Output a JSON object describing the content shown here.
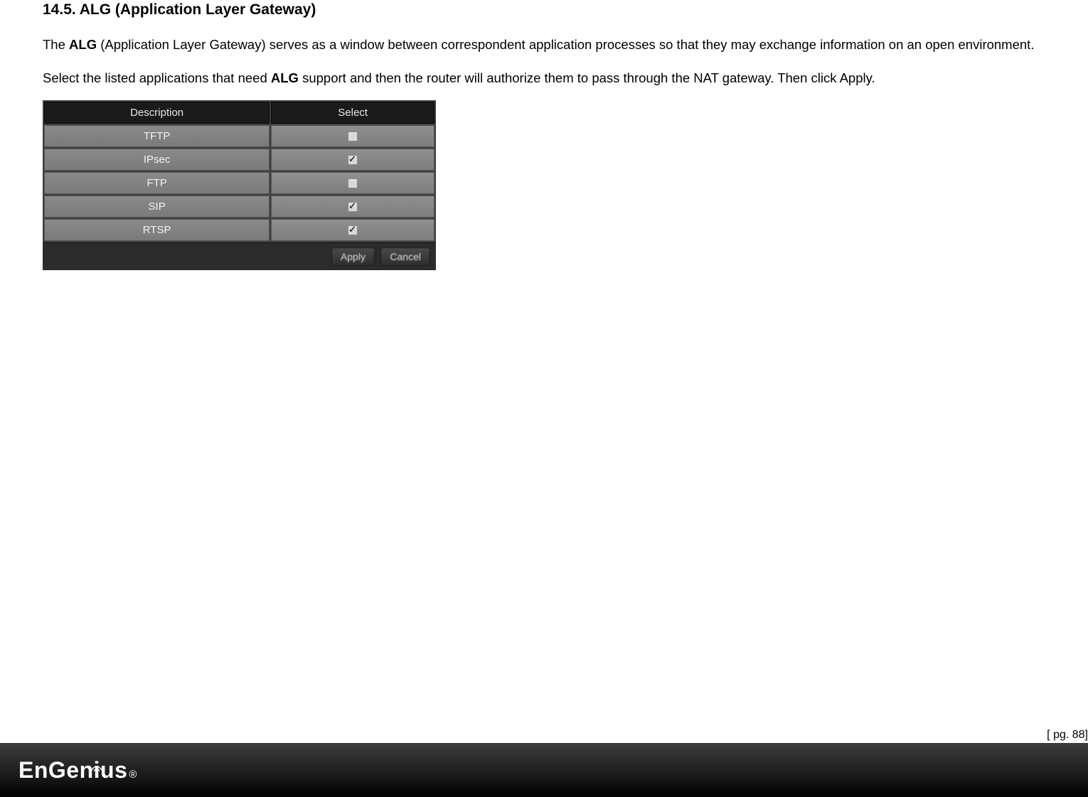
{
  "section": {
    "heading": "14.5.  ALG (Application Layer Gateway)",
    "para1_lead": "The ",
    "para1_bold1": "ALG",
    "para1_mid": " (Application Layer Gateway) serves as a window between correspondent application processes so that they may exchange information on an open environment.",
    "para2_lead": "Select the listed applications that need ",
    "para2_bold1": "ALG",
    "para2_tail": " support and then the router will authorize them to pass through the NAT gateway. Then click Apply."
  },
  "table": {
    "headers": {
      "description": "Description",
      "select": "Select"
    },
    "rows": [
      {
        "description": "TFTP",
        "checked": false
      },
      {
        "description": "IPsec",
        "checked": true
      },
      {
        "description": "FTP",
        "checked": false
      },
      {
        "description": "SIP",
        "checked": true
      },
      {
        "description": "RTSP",
        "checked": true
      }
    ],
    "buttons": {
      "apply": "Apply",
      "cancel": "Cancel"
    }
  },
  "footer": {
    "page": "[ pg. 88]",
    "brand": "EnGenius",
    "reg": "®"
  }
}
